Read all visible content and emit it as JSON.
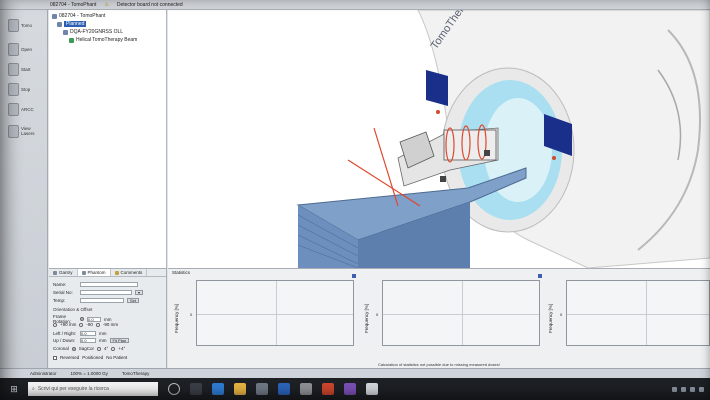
{
  "topbar": {
    "patient_id": "082704 - TomoPhant",
    "warning_text": "Detector board not connected",
    "warning_color": "#c29b00"
  },
  "toolbar": {
    "items": [
      {
        "label": "Tomo",
        "icon": "tomo-icon"
      },
      {
        "label": "Open",
        "icon": "folder-icon"
      },
      {
        "label": "Start",
        "icon": "play-icon"
      },
      {
        "label": "Stop",
        "icon": "stop-icon"
      },
      {
        "label": "ARCC",
        "icon": "arc-icon"
      },
      {
        "label": "View",
        "icon": "view-icon"
      },
      {
        "label": "Lasers",
        "icon": "laser-icon"
      }
    ]
  },
  "tree": {
    "nodes": [
      {
        "label": "082704 - TomoPhant"
      },
      {
        "label": "Planned"
      },
      {
        "label": "DQA-FY20GNRSS OLL"
      },
      {
        "label": "Helical TomoTherapy Beam"
      }
    ]
  },
  "props": {
    "tabs": [
      {
        "label": "Gantry"
      },
      {
        "label": "Phantom"
      },
      {
        "label": "Comments"
      }
    ],
    "fields": {
      "name_label": "Name:",
      "serial_label": "Serial No:",
      "temp_label": "Temp:",
      "set_label": "Set"
    },
    "group_title": "Orientation & Offset",
    "frame_label": "Frame Rotation:",
    "frame_value": "0.0",
    "frame_unit": "mm",
    "options": [
      "+90 mm",
      "-90",
      "-90 mm"
    ],
    "left_right_label": "Left / Right:",
    "left_right_value": "0.0",
    "up_down_label": "Up / Down:",
    "up_down_value": "0.0",
    "fit_button": "Fit Plan",
    "coronal_label": "Coronal",
    "sagcor_label": "SagCor",
    "deg4": "4°",
    "deg4p": "+4°",
    "reversed_label": "Reversed",
    "positioned_label": "Positioned",
    "no_patient_label": "No Patient"
  },
  "stats": {
    "title": "Statistics",
    "ylabel": "Frequency [%]",
    "zero": "0",
    "message": "Calculation of statistics not possible due to missing measured doses!"
  },
  "status": {
    "user": "Administrator",
    "zoom": "100% = 1.0000 Gy",
    "app": "TomoTherapy"
  },
  "taskbar": {
    "search_placeholder": "Scrivi qui per eseguire la ricerca"
  },
  "view3d": {
    "machine_label": "TomoTherapy",
    "accent_blue": "#1a2f8a",
    "couch_color": "#7fa0c8",
    "bore_color": "#a9dff0",
    "laser_color": "#e0472c"
  }
}
